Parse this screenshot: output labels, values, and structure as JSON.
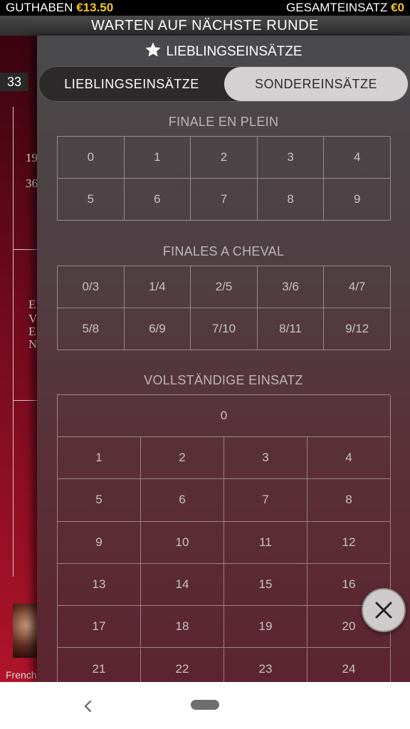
{
  "status_bar": {
    "balance_label": "GUTHABEN",
    "balance_value": "€13.50",
    "total_bet_label": "GESAMTEINSATZ",
    "total_bet_value": "€0"
  },
  "banner": {
    "text": "WARTEN AUF NÄCHSTE RUNDE"
  },
  "background": {
    "round_number": "33",
    "text_fragments": [
      "19",
      "36",
      "E",
      "V",
      "E",
      "N"
    ],
    "caption": "French"
  },
  "panel": {
    "title": "LIEBLINGSEINSÄTZE",
    "title_icon": "star-icon",
    "tabs": [
      {
        "label": "LIEBLINGSEINSÄTZE",
        "active": false
      },
      {
        "label": "SONDEREINSÄTZE",
        "active": true
      }
    ],
    "sections": {
      "finale_en_plein": {
        "title": "FINALE EN PLEIN",
        "cells": [
          "0",
          "1",
          "2",
          "3",
          "4",
          "5",
          "6",
          "7",
          "8",
          "9"
        ]
      },
      "finales_a_cheval": {
        "title": "FINALES A CHEVAL",
        "cells": [
          "0/3",
          "1/4",
          "2/5",
          "3/6",
          "4/7",
          "5/8",
          "6/9",
          "7/10",
          "8/11",
          "9/12"
        ]
      },
      "vollstaendige": {
        "title": "VOLLSTÄNDIGE EINSATZ",
        "zero": "0",
        "cells": [
          "1",
          "2",
          "3",
          "4",
          "5",
          "6",
          "7",
          "8",
          "9",
          "10",
          "11",
          "12",
          "13",
          "14",
          "15",
          "16",
          "17",
          "18",
          "19",
          "20",
          "21",
          "22",
          "23",
          "24"
        ]
      }
    },
    "close_icon": "close-icon"
  },
  "navbar": {
    "back_icon": "back-chevron-icon",
    "home_icon": "home-pill-icon"
  },
  "colors": {
    "accent_yellow": "#f5c518",
    "panel_bg": "#4e3f43",
    "bg_red": "#8e0f22"
  }
}
